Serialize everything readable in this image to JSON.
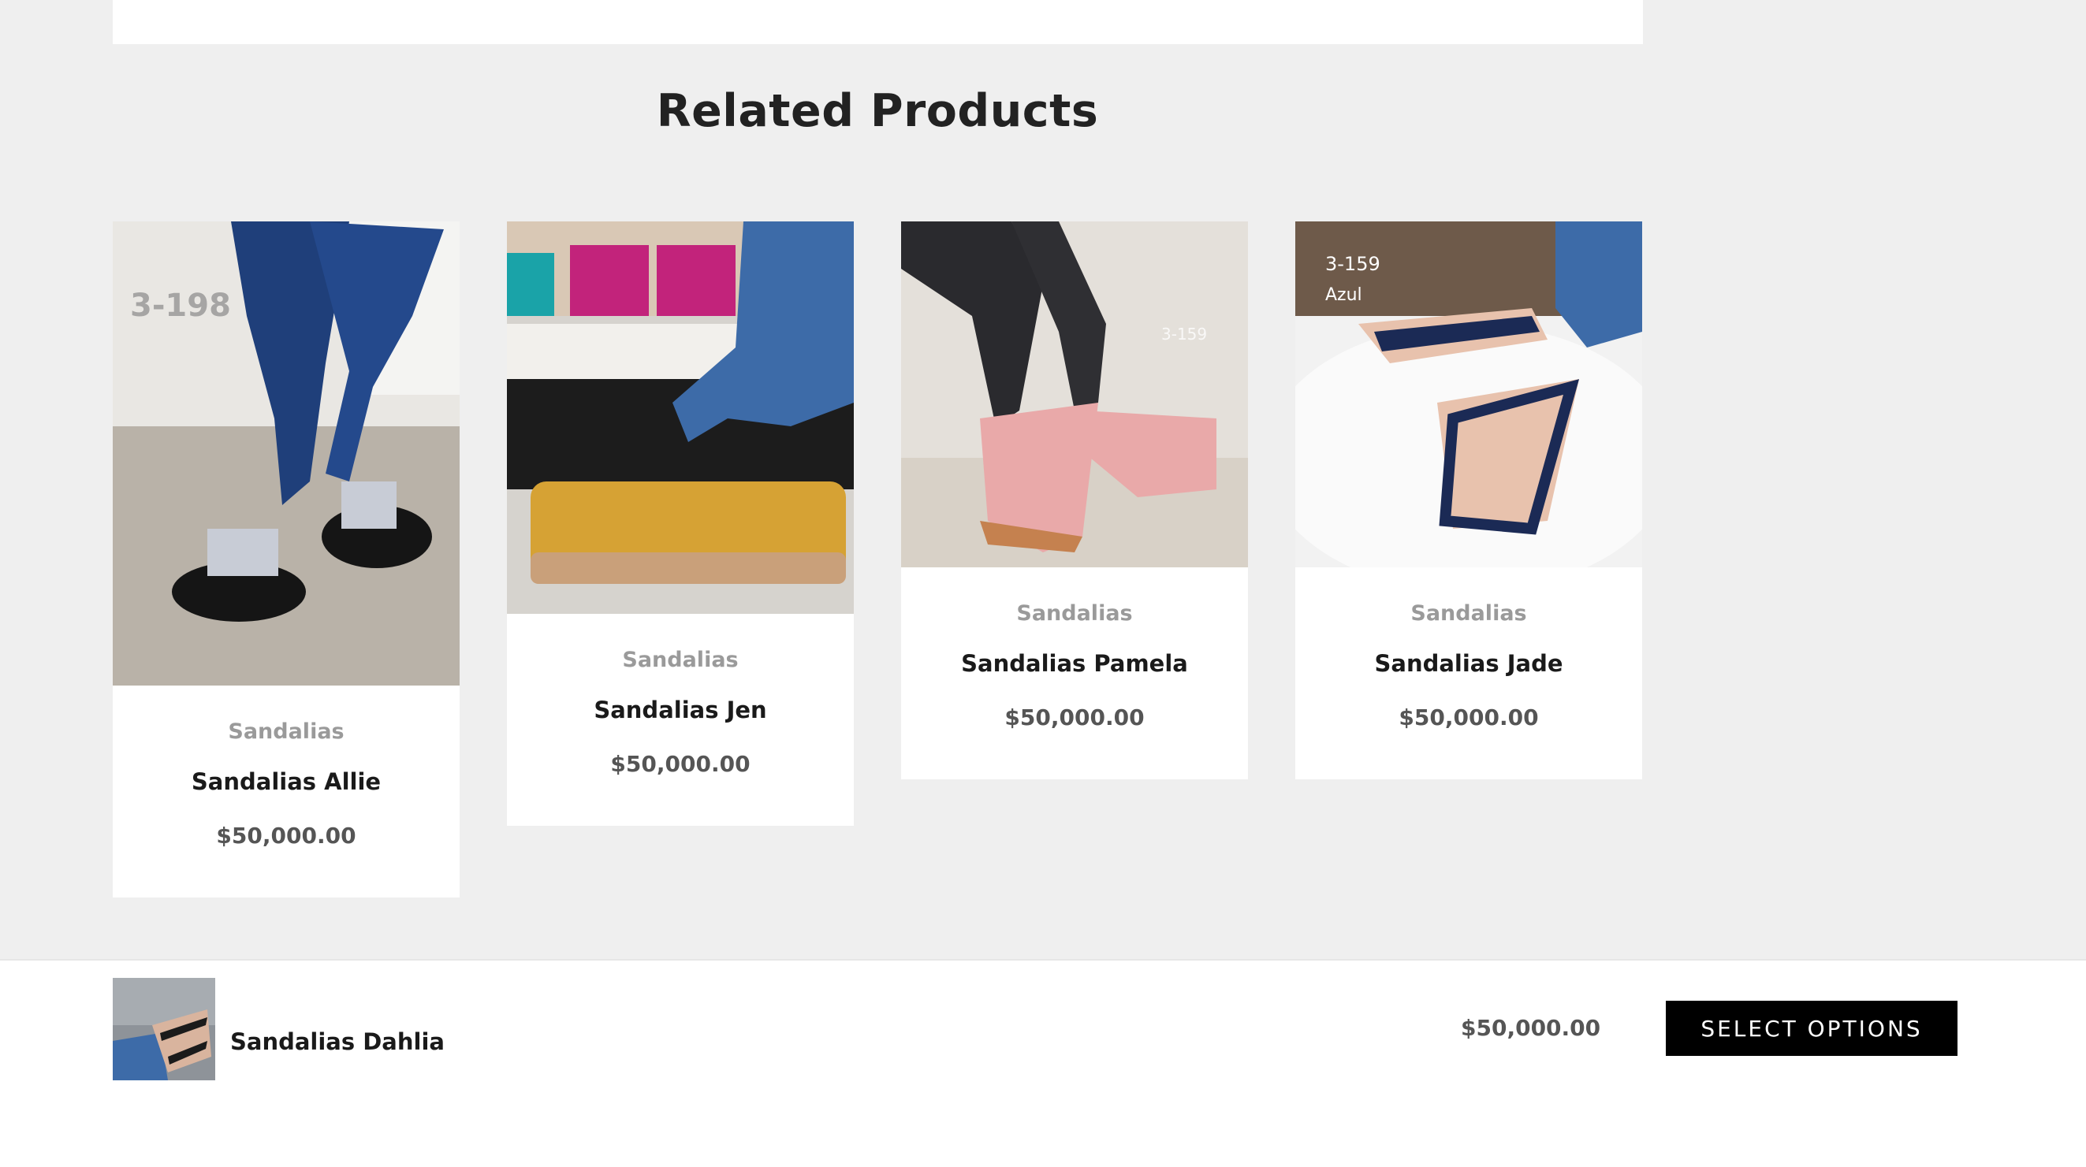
{
  "section": {
    "title": "Related Products"
  },
  "products": [
    {
      "category": "Sandalias",
      "name": "Sandalias Allie",
      "price": "$50,000.00",
      "image_label": "3-198"
    },
    {
      "category": "Sandalias",
      "name": "Sandalias Jen",
      "price": "$50,000.00"
    },
    {
      "category": "Sandalias",
      "name": "Sandalias Pamela",
      "price": "$50,000.00",
      "image_label": "3-159"
    },
    {
      "category": "Sandalias",
      "name": "Sandalias Jade",
      "price": "$50,000.00",
      "image_label": "3-159",
      "image_sublabel": "Azul"
    }
  ],
  "sticky_bar": {
    "product_name": "Sandalias Dahlia",
    "price": "$50,000.00",
    "button_label": "SELECT OPTIONS"
  }
}
